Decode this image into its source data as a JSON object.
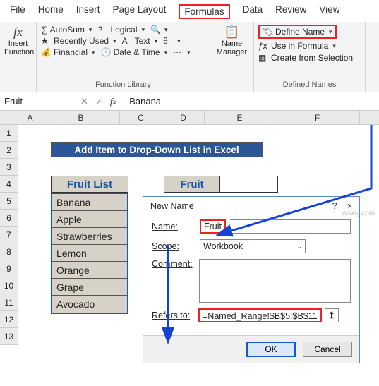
{
  "tabs": {
    "t0": "File",
    "t1": "Home",
    "t2": "Insert",
    "t3": "Page Layout",
    "t4": "Formulas",
    "t5": "Data",
    "t6": "Review",
    "t7": "View"
  },
  "ribbon": {
    "insert_fn": "Insert\nFunction",
    "flib": {
      "autosum": "AutoSum",
      "recent": "Recently Used",
      "financial": "Financial",
      "logical": "Logical",
      "text": "Text",
      "date": "Date & Time",
      "label": "Function Library"
    },
    "nm": "Name\nManager",
    "dn": {
      "define": "Define Name",
      "use": "Use in Formula",
      "create": "Create from Selection",
      "label": "Defined Names"
    }
  },
  "namebox": "Fruit",
  "formula": "Banana",
  "cols": {
    "A": "A",
    "B": "B",
    "C": "C",
    "D": "D",
    "E": "E",
    "F": "F"
  },
  "rows": [
    "1",
    "2",
    "3",
    "4",
    "5",
    "6",
    "7",
    "8",
    "9",
    "10",
    "11",
    "12",
    "13"
  ],
  "banner": "Add Item to Drop-Down List in Excel",
  "th1": "Fruit List",
  "th2": "Fruit",
  "items": [
    "Banana",
    "Apple",
    "Strawberries",
    "Lemon",
    "Orange",
    "Grape",
    "Avocado"
  ],
  "dialog": {
    "title": "New Name",
    "help": "?",
    "close": "×",
    "name_lbl": "Name:",
    "name_val": "Fruit",
    "scope_lbl": "Scope:",
    "scope_val": "Workbook",
    "comment_lbl": "Comment:",
    "refers_lbl": "Refers to:",
    "refers_val": "=Named_Range!$B$5:$B$11",
    "ok": "OK",
    "cancel": "Cancel"
  },
  "watermark": "wsxsj.com",
  "chart_data": {
    "type": "table",
    "title": "Fruit List",
    "categories": [
      "B5",
      "B6",
      "B7",
      "B8",
      "B9",
      "B10",
      "B11"
    ],
    "values": [
      "Banana",
      "Apple",
      "Strawberries",
      "Lemon",
      "Orange",
      "Grape",
      "Avocado"
    ]
  }
}
